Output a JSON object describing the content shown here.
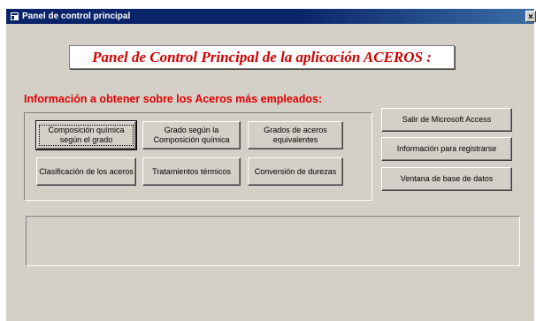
{
  "window": {
    "title": "Panel de control principal",
    "close_glyph": "×"
  },
  "header": {
    "title": "Panel de Control Principal de la aplicación ACEROS :"
  },
  "section": {
    "label": "Información a obtener sobre los Aceros más empleados:"
  },
  "buttons": {
    "composicion": "Composición química según el grado",
    "grado": "Grado según la Composición química",
    "equivalentes": "Grados de aceros equivalentes",
    "clasificacion": "Clasificación de los aceros",
    "tratamientos": "Tratamientos térmicos",
    "conversion": "Conversión de durezas",
    "salir": "Salir de Microsoft Access",
    "registro": "Información para registrarse",
    "ventana_bd": "Ventana de base de datos"
  },
  "colors": {
    "titlebar": "#0a246a",
    "accent_red": "#e00000",
    "face": "#d4d0c8"
  }
}
